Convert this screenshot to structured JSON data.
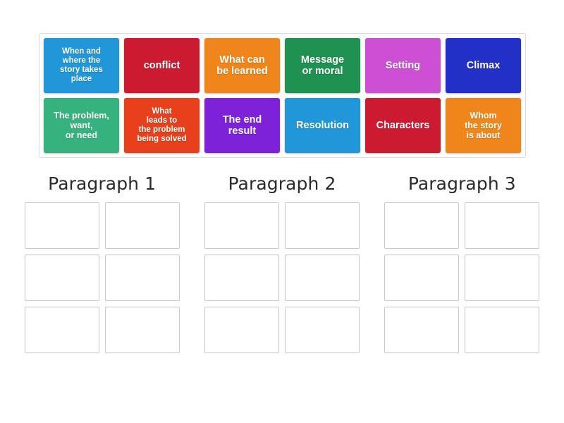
{
  "page": {
    "background": "#ffffff"
  },
  "tile_bank": {
    "name": "word-tile-bank",
    "rows": [
      [
        {
          "label": "When and\nwhere the\nstory takes\nplace",
          "color": "#2196d9",
          "size": "xsmall"
        },
        {
          "label": "conflict",
          "color": "#cc1b31",
          "size": "normal"
        },
        {
          "label": "What can\nbe learned",
          "color": "#f0861b",
          "size": "normal"
        },
        {
          "label": "Message\nor moral",
          "color": "#1f9150",
          "size": "normal"
        },
        {
          "label": "Setting",
          "color": "#cc4fd4",
          "size": "normal"
        },
        {
          "label": "Climax",
          "color": "#2330c8",
          "size": "normal"
        }
      ],
      [
        {
          "label": "The problem,\nwant,\nor need",
          "color": "#36b27e",
          "size": "small"
        },
        {
          "label": "What\nleads to\nthe problem\nbeing solved",
          "color": "#e8401c",
          "size": "xsmall"
        },
        {
          "label": "The end\nresult",
          "color": "#7d22d8",
          "size": "normal"
        },
        {
          "label": "Resolution",
          "color": "#2196d9",
          "size": "normal"
        },
        {
          "label": "Characters",
          "color": "#cc1b31",
          "size": "normal"
        },
        {
          "label": "Whom\nthe story\nis about",
          "color": "#f0861b",
          "size": "small"
        }
      ]
    ]
  },
  "columns": [
    {
      "title": "Paragraph 1",
      "slots": [
        "",
        "",
        "",
        "",
        "",
        ""
      ]
    },
    {
      "title": "Paragraph 2",
      "slots": [
        "",
        "",
        "",
        "",
        "",
        ""
      ]
    },
    {
      "title": "Paragraph 3",
      "slots": [
        "",
        "",
        "",
        "",
        "",
        ""
      ]
    }
  ]
}
